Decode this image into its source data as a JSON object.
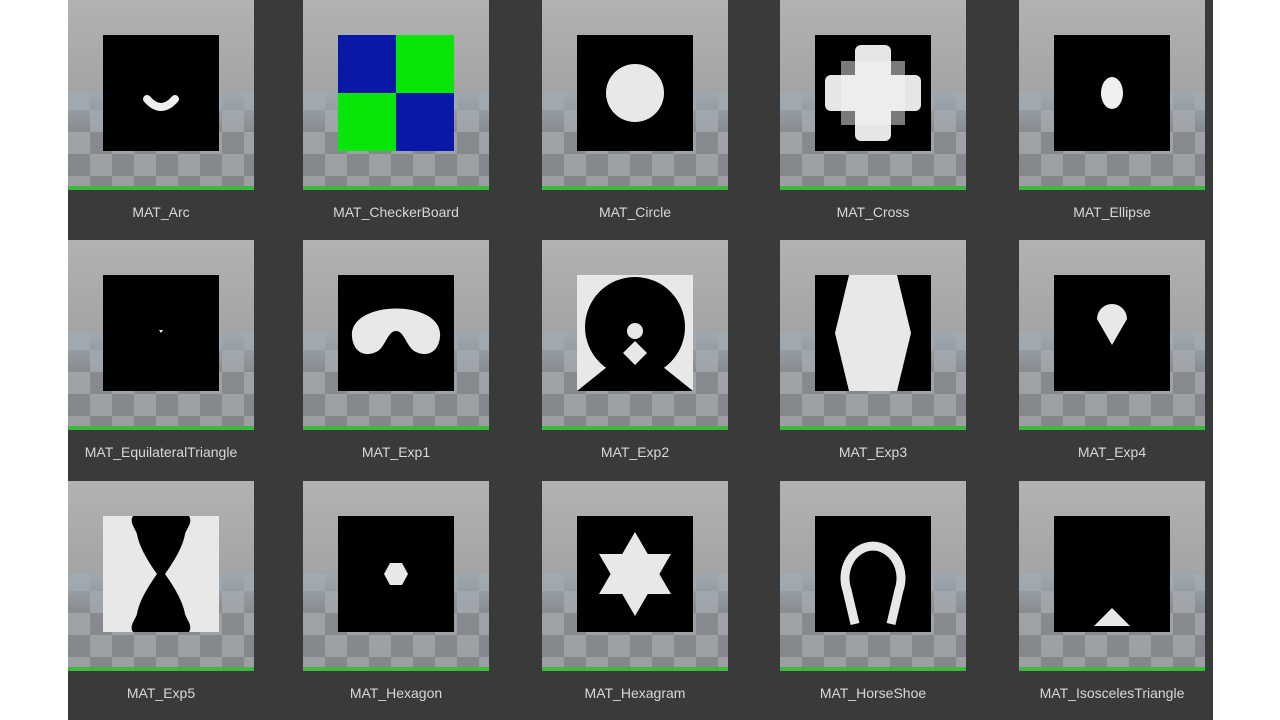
{
  "assets": [
    {
      "name": "MAT_Arc",
      "icon": "arc-icon"
    },
    {
      "name": "MAT_CheckerBoard",
      "icon": "checkerboard-icon"
    },
    {
      "name": "MAT_Circle",
      "icon": "circle-icon"
    },
    {
      "name": "MAT_Cross",
      "icon": "cross-icon"
    },
    {
      "name": "MAT_Ellipse",
      "icon": "ellipse-icon"
    },
    {
      "name": "MAT_EquilateralTriangle",
      "icon": "equilateral-triangle-icon"
    },
    {
      "name": "MAT_Exp1",
      "icon": "exp1-icon"
    },
    {
      "name": "MAT_Exp2",
      "icon": "exp2-icon"
    },
    {
      "name": "MAT_Exp3",
      "icon": "exp3-icon"
    },
    {
      "name": "MAT_Exp4",
      "icon": "exp4-icon"
    },
    {
      "name": "MAT_Exp5",
      "icon": "exp5-icon"
    },
    {
      "name": "MAT_Hexagon",
      "icon": "hexagon-icon"
    },
    {
      "name": "MAT_Hexagram",
      "icon": "hexagram-icon"
    },
    {
      "name": "MAT_HorseShoe",
      "icon": "horseshoe-icon"
    },
    {
      "name": "MAT_IsoscelesTriangle",
      "icon": "isosceles-triangle-icon"
    }
  ],
  "colors": {
    "panel_bg": "#3a3a3a",
    "label_text": "#d8d8d8",
    "asset_type_bar": "#3fb83f",
    "shape_fill": "#e8e8e8",
    "shape_bg": "#000000",
    "checker_blue": "#0a18a8",
    "checker_green": "#08e608"
  }
}
